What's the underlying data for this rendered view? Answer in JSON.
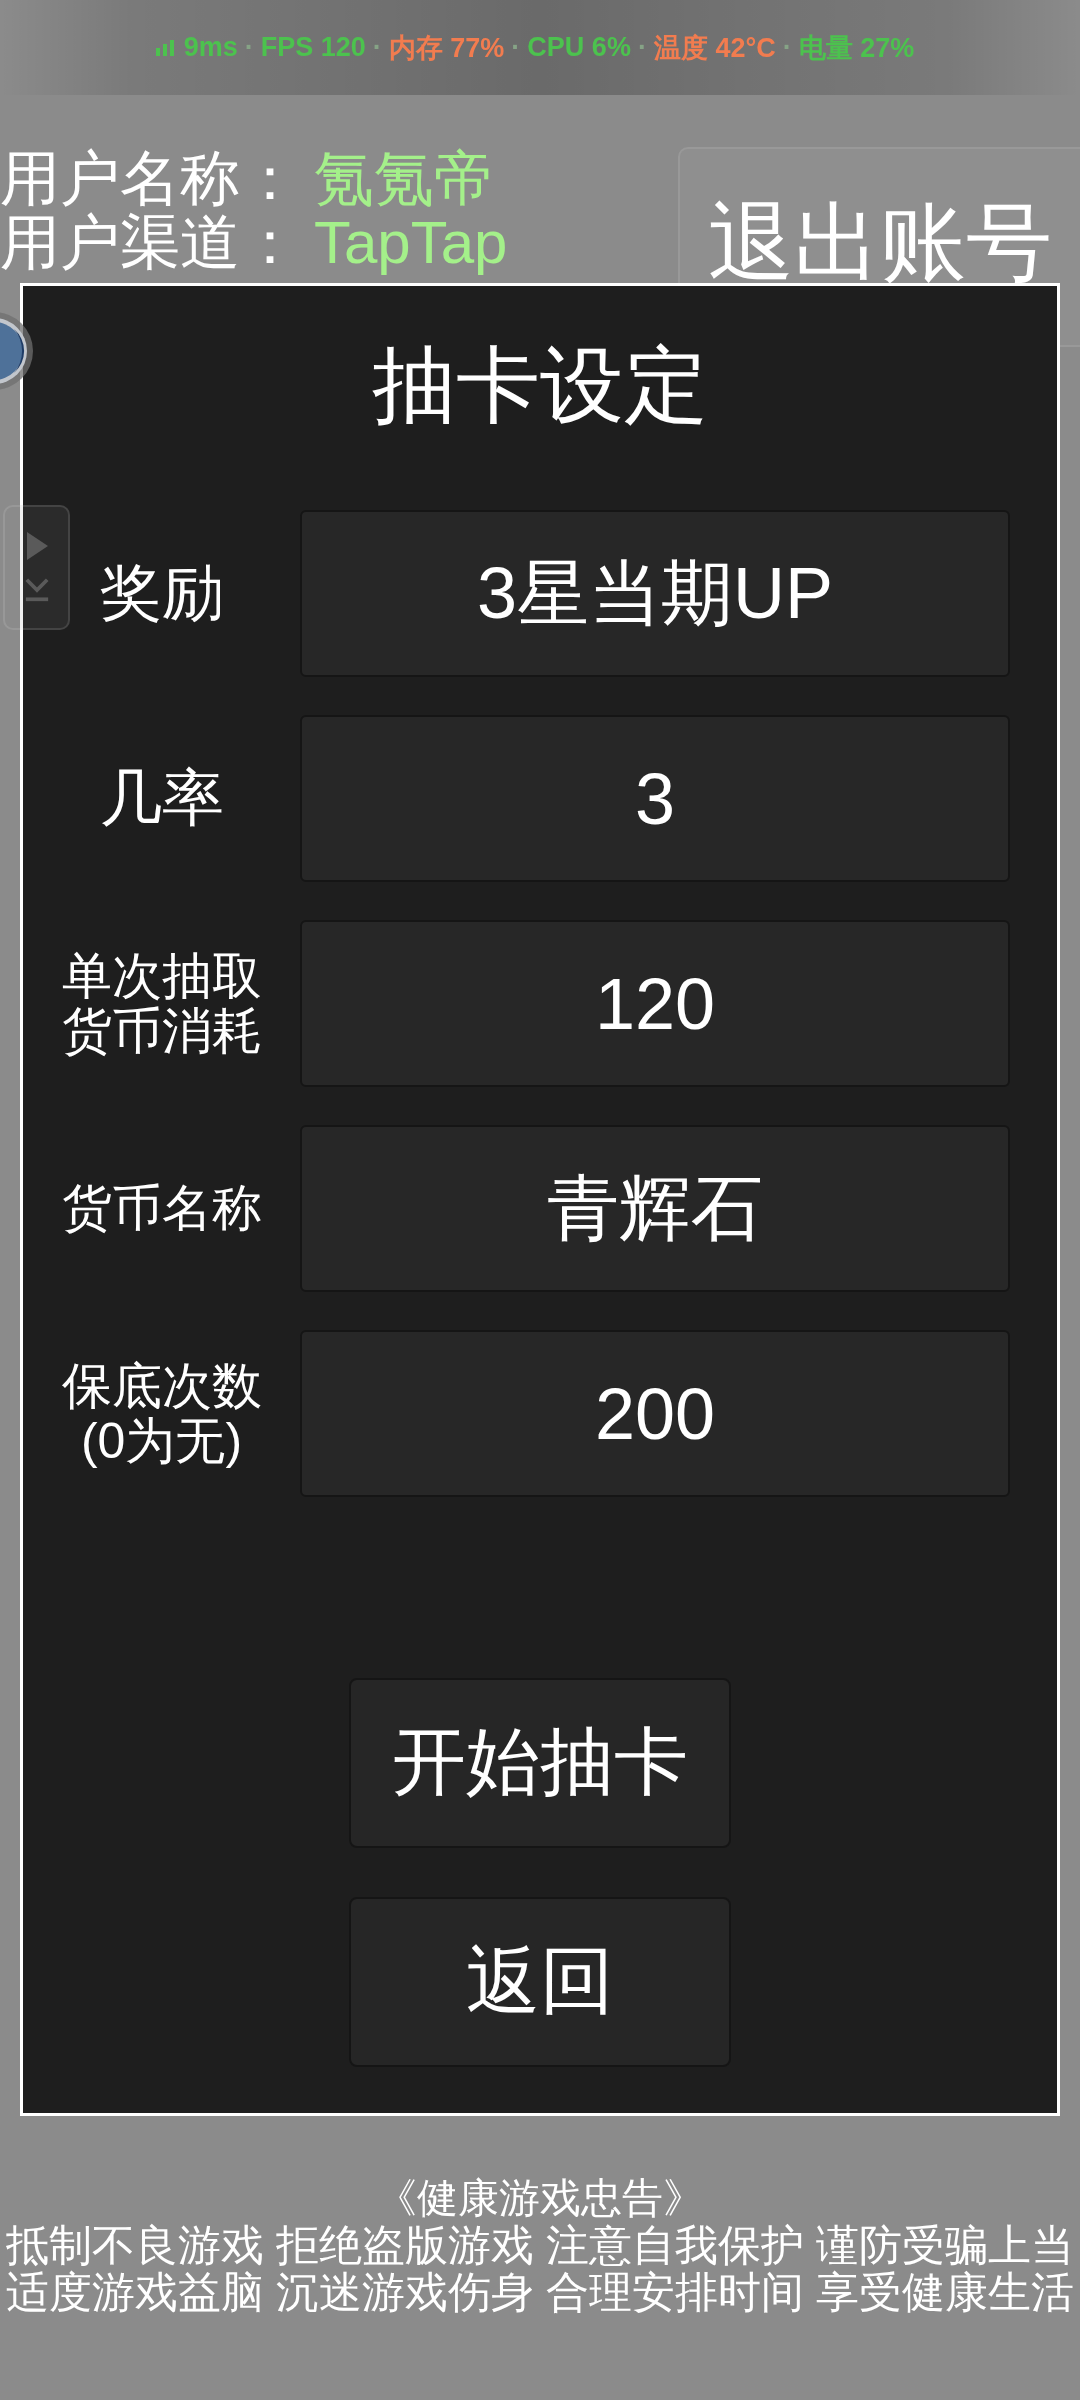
{
  "status_overlay": {
    "metrics": [
      {
        "text": "9ms",
        "color": "#4cc24e"
      },
      {
        "text": "FPS 120",
        "color": "#4cc24e"
      },
      {
        "text": "内存 77%",
        "color": "#f27c4f"
      },
      {
        "text": "CPU 6%",
        "color": "#4cc24e"
      },
      {
        "text": "温度 42°C",
        "color": "#f27c4f"
      },
      {
        "text": "电量 27%",
        "color": "#4cc24e"
      }
    ],
    "separators": [
      "·",
      "·",
      "·",
      "·",
      "·"
    ]
  },
  "account": {
    "fields": [
      {
        "label": "用户名称：",
        "value": "氪氪帝"
      },
      {
        "label": "用户渠道：",
        "value": "TapTap"
      }
    ],
    "logout_button": "退出账号"
  },
  "dialog": {
    "title": "抽卡设定",
    "fields": [
      {
        "label": "奖励",
        "value": "3星当期UP"
      },
      {
        "label": "几率",
        "value": "3"
      },
      {
        "label": "单次抽取货币消耗",
        "value": "120"
      },
      {
        "label": "货币名称",
        "value": "青辉石"
      },
      {
        "label": "保底次数(0为无)",
        "value": "200"
      }
    ],
    "buttons": [
      "开始抽卡",
      "返回"
    ]
  },
  "health_advisory": {
    "title": "《健康游戏忠告》",
    "lines": [
      "抵制不良游戏 拒绝盗版游戏 注意自我保护 谨防受骗上当",
      "适度游戏益脑 沉迷游戏伤身 合理安排时间 享受健康生活"
    ]
  }
}
